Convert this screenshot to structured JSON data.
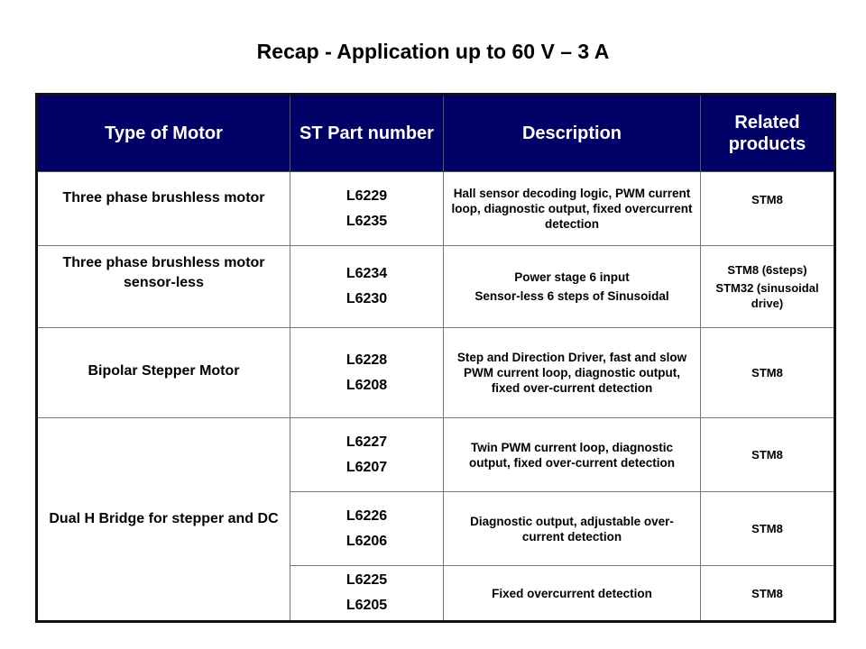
{
  "title": "Recap - Application up to 60 V – 3 A",
  "colors": {
    "header_bg": "#000066",
    "header_text": "#ffffff"
  },
  "table": {
    "headers": [
      "Type of Motor",
      "ST Part number",
      "Description",
      "Related products"
    ],
    "rows": [
      {
        "type": "Three phase brushless motor",
        "parts": [
          "L6229",
          "L6235"
        ],
        "description": "Hall sensor decoding logic, PWM current loop, diagnostic output, fixed overcurrent detection",
        "related": [
          "STM8"
        ]
      },
      {
        "type": "Three phase brushless motor sensor-less",
        "parts": [
          "L6234",
          "L6230"
        ],
        "description_lines": [
          "Power stage 6 input",
          "Sensor-less 6 steps of Sinusoidal"
        ],
        "related": [
          "STM8 (6steps)",
          "STM32 (sinusoidal drive)"
        ]
      },
      {
        "type": "Bipolar Stepper Motor",
        "parts": [
          "L6228",
          "L6208"
        ],
        "description": "Step and Direction Driver, fast and slow PWM current loop, diagnostic output, fixed over-current detection",
        "related": [
          "STM8"
        ]
      },
      {
        "type": "Dual H Bridge for stepper and DC",
        "parts": [
          "L6227",
          "L6207"
        ],
        "description": "Twin PWM current loop, diagnostic output, fixed over-current detection",
        "related": [
          "STM8"
        ]
      },
      {
        "parts": [
          "L6226",
          "L6206"
        ],
        "description": "Diagnostic output, adjustable over-current detection",
        "related": [
          "STM8"
        ]
      },
      {
        "parts": [
          "L6225",
          "L6205"
        ],
        "description": "Fixed overcurrent detection",
        "related": [
          "STM8"
        ]
      }
    ]
  }
}
